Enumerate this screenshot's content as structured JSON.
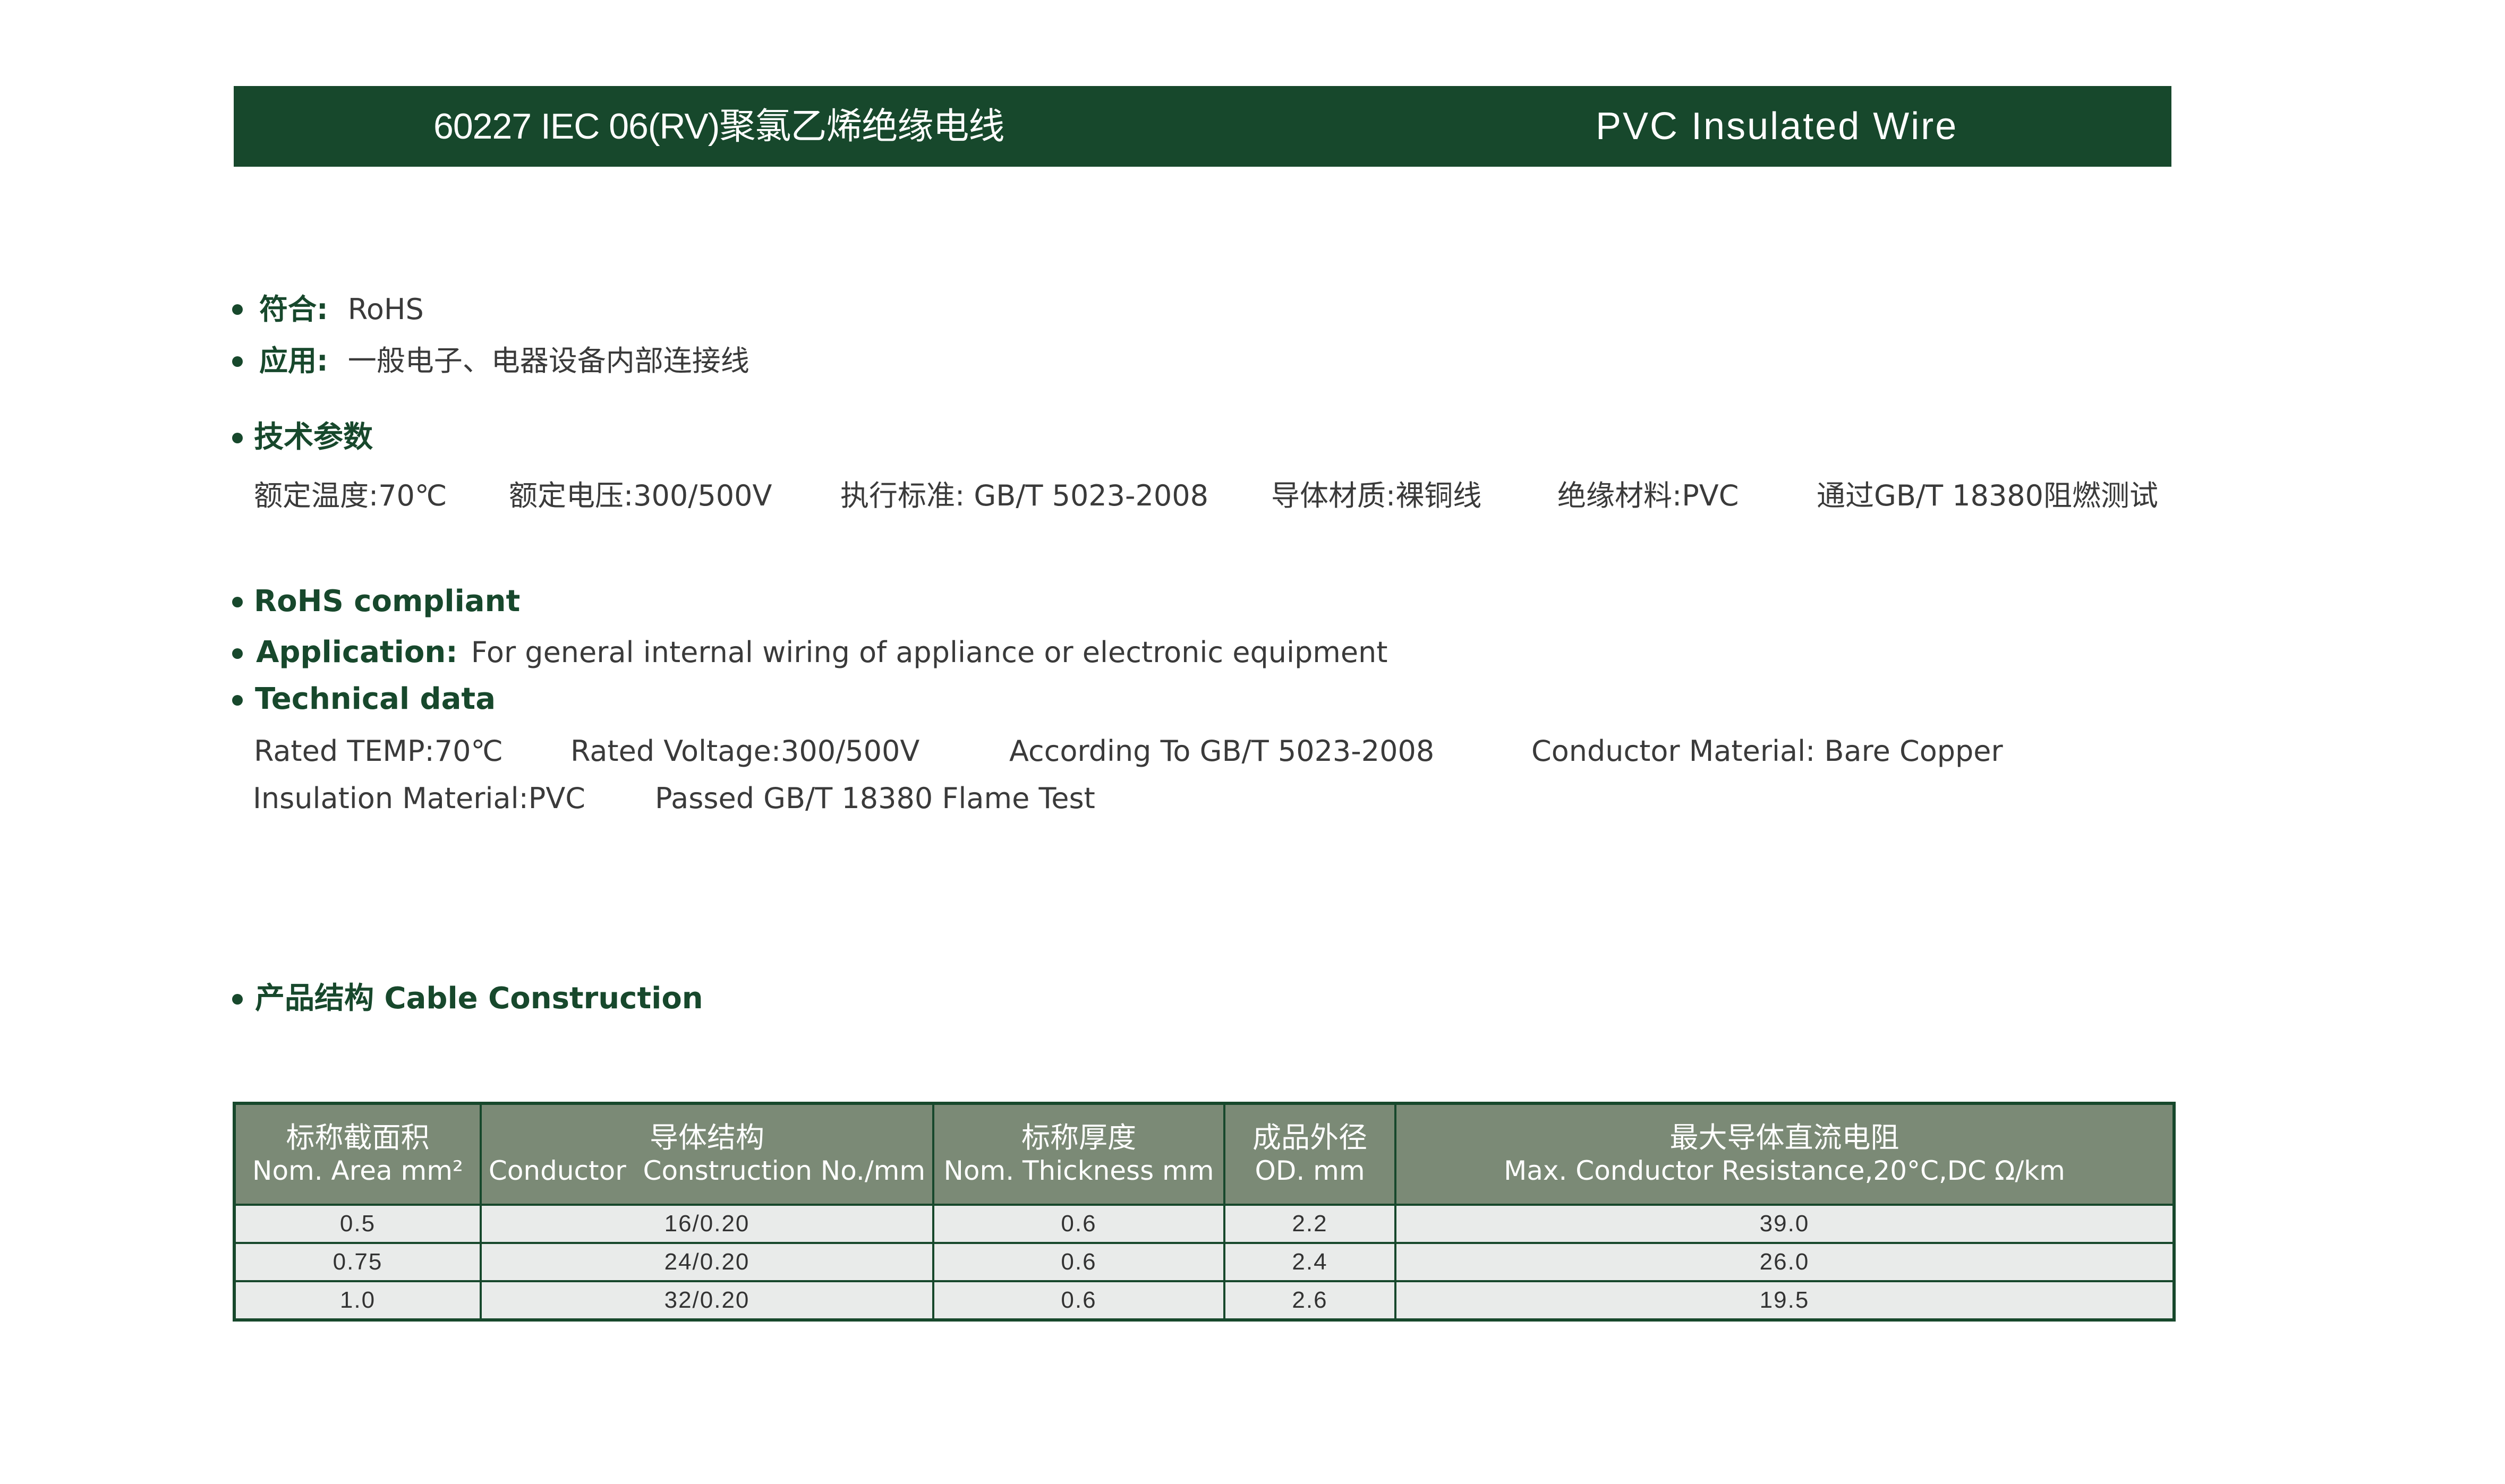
{
  "header": {
    "title_zh": "60227 IEC 06(RV)聚氯乙烯绝缘电线",
    "title_en": "PVC Insulated Wire"
  },
  "zh": {
    "conform_label": "符合:",
    "conform_value": "RoHS",
    "application_label": "应用:",
    "application_value": "一般电子、电器设备内部连接线",
    "tech_heading": "技术参数",
    "tech_params": [
      "额定温度:70℃",
      "额定电压:300/500V",
      "执行标准: GB/T 5023-2008",
      "导体材质:裸铜线",
      "绝缘材料:PVC",
      "通过GB/T 18380阻燃测试"
    ]
  },
  "en": {
    "rohs": "RoHS compliant",
    "application_label": "Application:",
    "application_value": "For general internal wiring of appliance or electronic equipment",
    "tech_heading": "Technical data",
    "tech_row1": [
      "Rated TEMP:70℃",
      "Rated Voltage:300/500V",
      "According To GB/T 5023-2008",
      "Conductor Material: Bare Copper"
    ],
    "tech_row2": [
      "Insulation Material:PVC",
      "Passed GB/T 18380 Flame Test"
    ]
  },
  "construction": {
    "heading": "产品结构 Cable Construction",
    "columns": [
      {
        "zh": "标称截面积",
        "en": "Nom. Area mm²"
      },
      {
        "zh": "导体结构",
        "en": "Conductor  Construction No./mm"
      },
      {
        "zh": "标称厚度",
        "en": "Nom. Thickness mm"
      },
      {
        "zh": "成品外径",
        "en": "OD. mm"
      },
      {
        "zh": "最大导体直流电阻",
        "en": "Max. Conductor Resistance,20°C,DC Ω/km"
      }
    ],
    "rows": [
      [
        "0.5",
        "16/0.20",
        "0.6",
        "2.2",
        "39.0"
      ],
      [
        "0.75",
        "24/0.20",
        "0.6",
        "2.4",
        "26.0"
      ],
      [
        "1.0",
        "32/0.20",
        "0.6",
        "2.6",
        "19.5"
      ]
    ]
  },
  "colors": {
    "brand_green": "#17482c",
    "table_header_bg": "#7b8a76",
    "table_row_bg": "#e9ebea"
  }
}
